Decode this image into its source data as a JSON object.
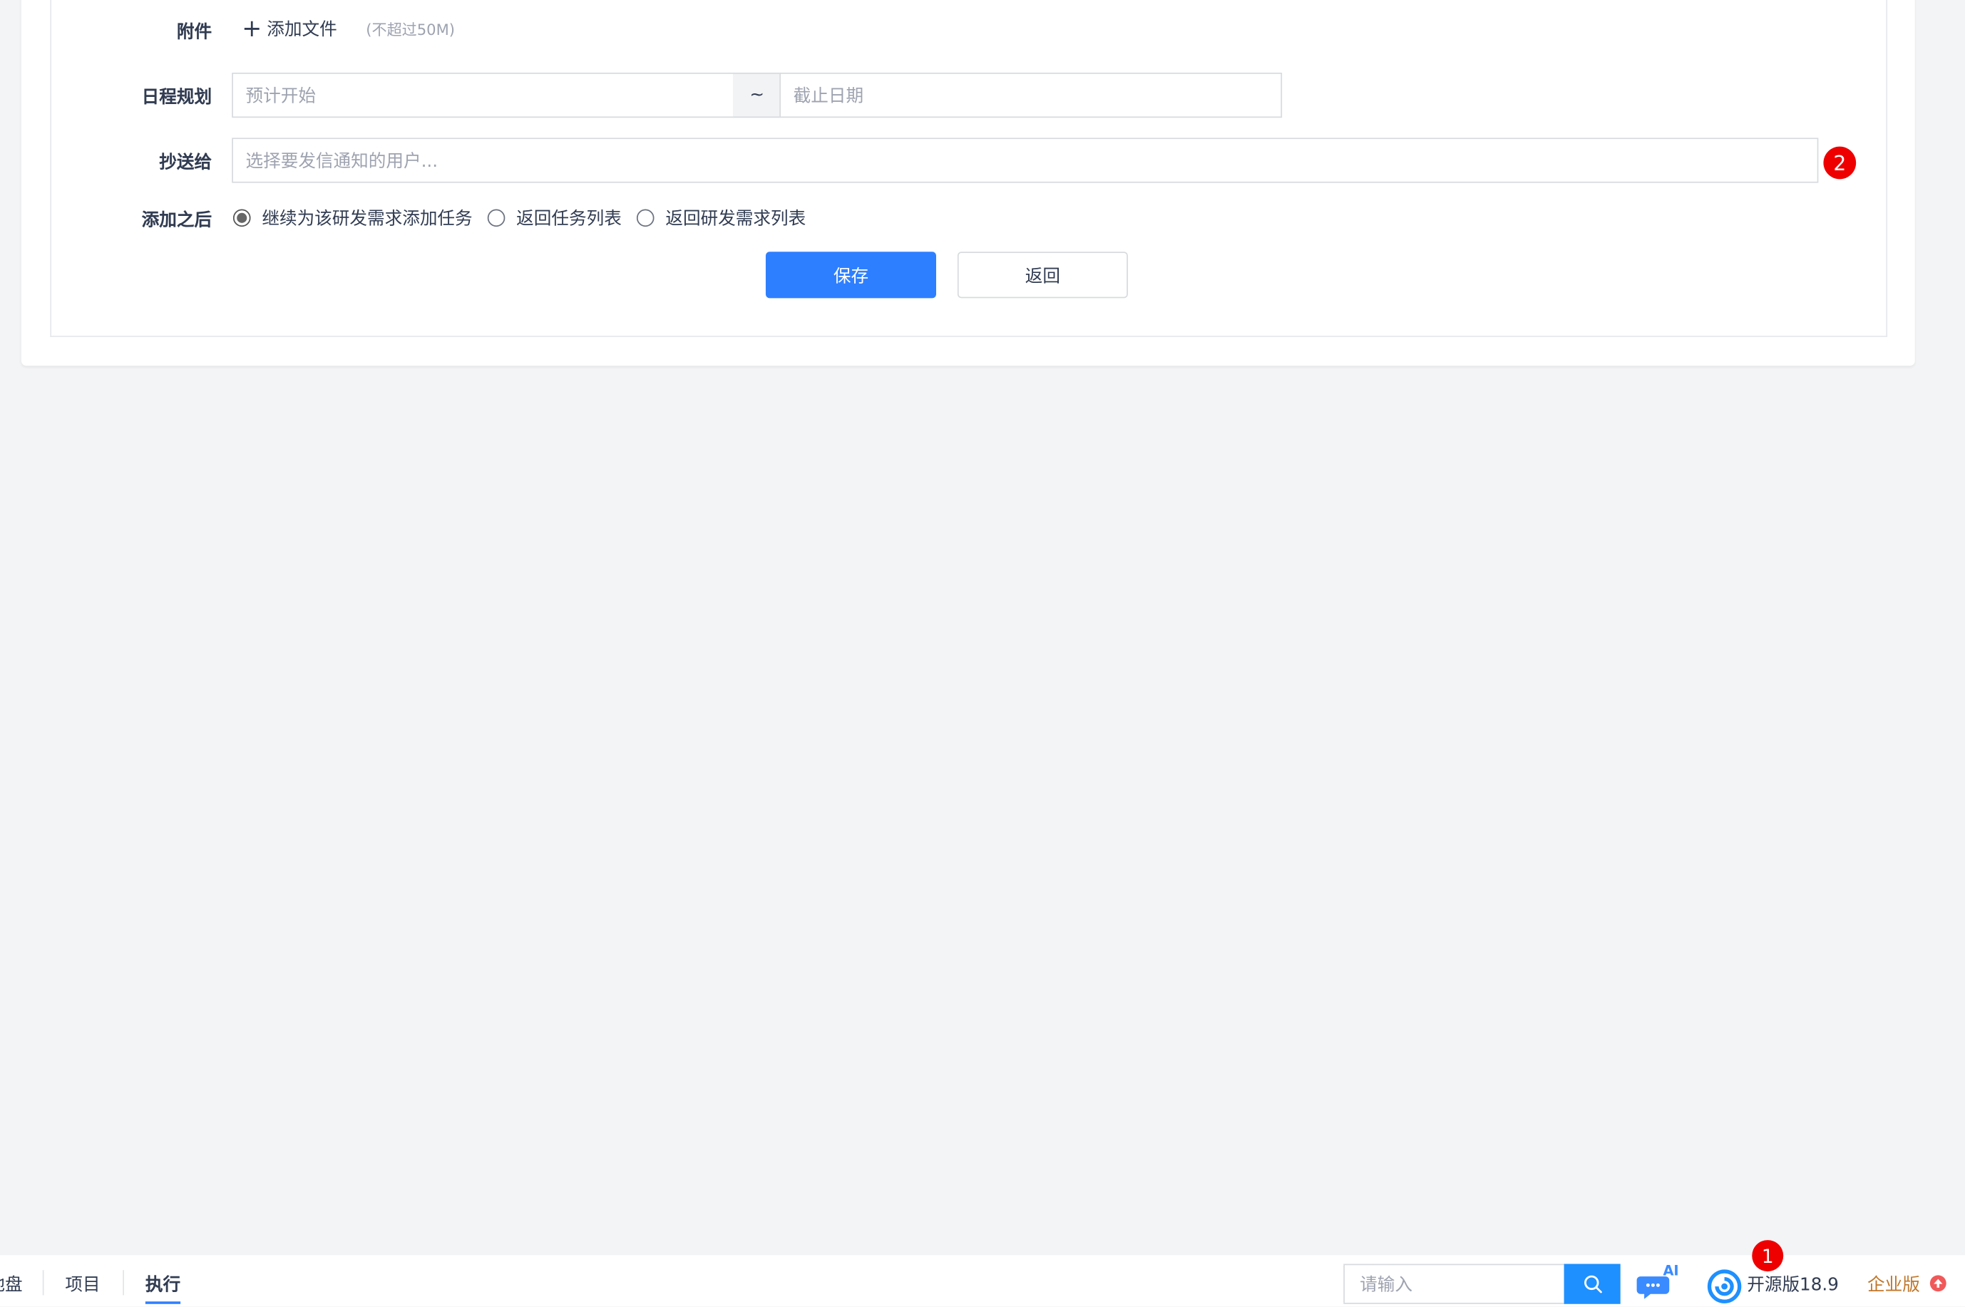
{
  "form": {
    "attachment": {
      "label": "附件",
      "add_file": "添加文件",
      "plus": "+",
      "hint": "(不超过50M)"
    },
    "schedule": {
      "label": "日程规划",
      "start_placeholder": "预计开始",
      "separator": "~",
      "end_placeholder": "截止日期"
    },
    "cc": {
      "label": "抄送给",
      "placeholder": "选择要发信通知的用户...",
      "badge": "2"
    },
    "after_add": {
      "label": "添加之后",
      "options": [
        {
          "label": "继续为该研发需求添加任务",
          "checked": true
        },
        {
          "label": "返回任务列表",
          "checked": false
        },
        {
          "label": "返回研发需求列表",
          "checked": false
        }
      ]
    },
    "buttons": {
      "save": "保存",
      "back": "返回"
    }
  },
  "footer": {
    "nav": [
      {
        "label": "地盘",
        "active": false
      },
      {
        "label": "项目",
        "active": false
      },
      {
        "label": "执行",
        "active": true
      }
    ],
    "search_placeholder": "请输入",
    "ai_label": "AI",
    "version_label": "开源版18.9",
    "version_badge": "1",
    "enterprise_label": "企业版"
  },
  "colors": {
    "primary": "#2e7fff",
    "badge": "#ee0000",
    "enterprise": "#c0772b"
  }
}
